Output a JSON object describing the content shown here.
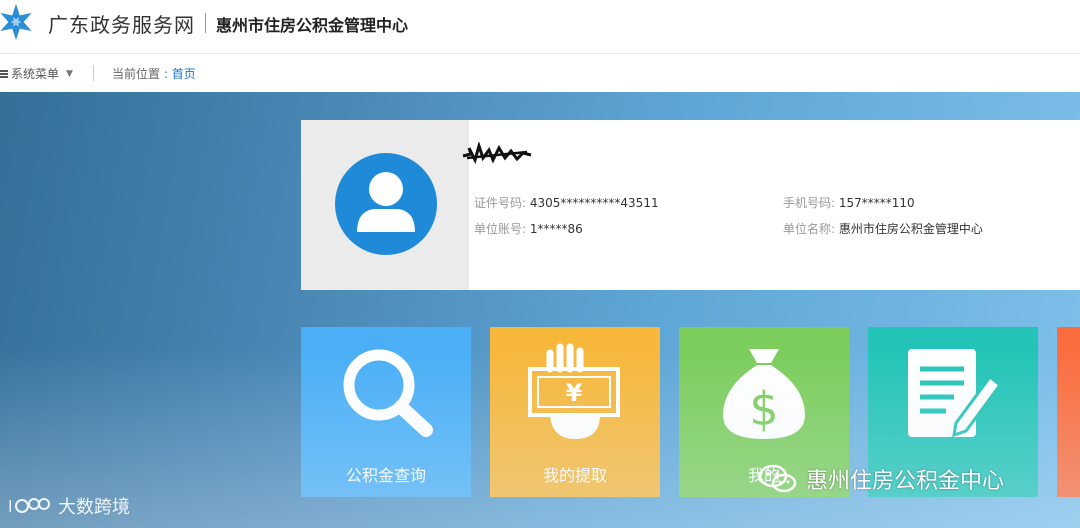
{
  "header": {
    "site_name": "广东政务服务网",
    "org_name": "惠州市住房公积金管理中心"
  },
  "toolbar": {
    "menu_label": "系统菜单",
    "breadcrumb_prefix": "当前位置 : ",
    "breadcrumb_current": "首页"
  },
  "profile": {
    "fields": {
      "id_label": "证件号码:",
      "id_value": "4305**********43511",
      "phone_label": "手机号码:",
      "phone_value": "157*****110",
      "account_label": "单位账号:",
      "account_value": "1*****86",
      "unit_label": "单位名称:",
      "unit_value": "惠州市住房公积金管理中心"
    }
  },
  "tiles": [
    {
      "label": "公积金查询",
      "icon": "magnifier-icon",
      "color": "#4aaff6"
    },
    {
      "label": "我的提取",
      "icon": "yuan-banknote-icon",
      "color": "#f7b73b"
    },
    {
      "label": "我的",
      "icon": "money-bag-icon",
      "color": "#7ccd5c"
    },
    {
      "label": "",
      "icon": "document-edit-icon",
      "color": "#23c4b7"
    },
    {
      "label": "",
      "icon": "",
      "color": "#fb6d3e"
    }
  ],
  "watermarks": {
    "left": "大数跨境",
    "right": "惠州住房公积金中心"
  }
}
